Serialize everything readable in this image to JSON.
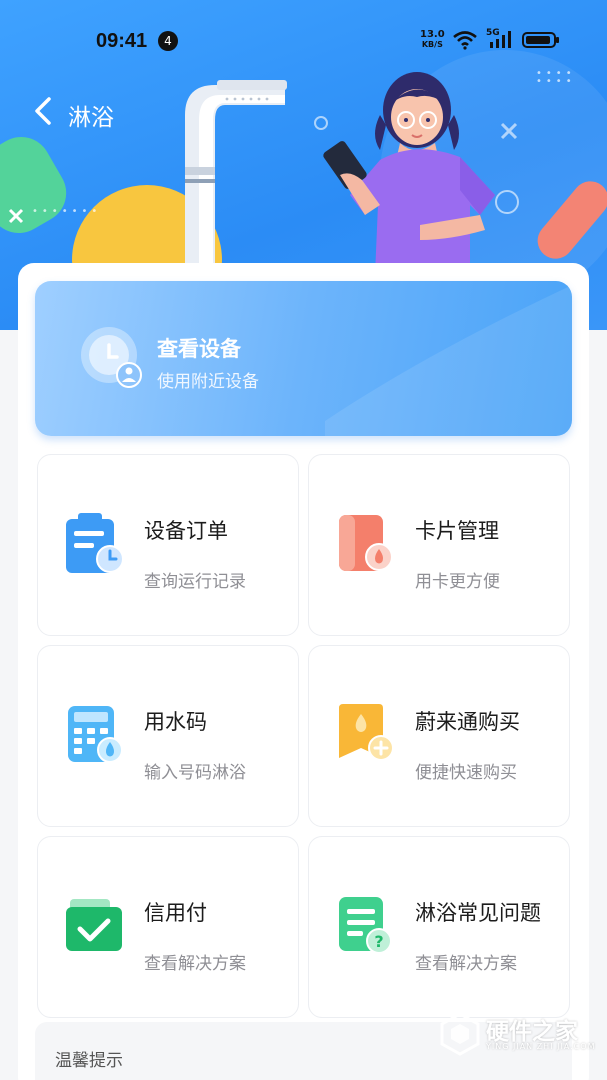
{
  "status_bar": {
    "time": "09:41",
    "notification_count": "4",
    "net_speed_value": "13.0",
    "net_speed_unit": "KB/S",
    "network_type": "5G"
  },
  "nav": {
    "title": "淋浴",
    "back_icon": "chevron-left-icon"
  },
  "primary_card": {
    "title": "查看设备",
    "subtitle": "使用附近设备",
    "icon": "clock-user-icon"
  },
  "tiles": [
    {
      "title": "设备订单",
      "subtitle": "查询运行记录",
      "icon": "clipboard-clock-icon",
      "color": "#3d9bf5"
    },
    {
      "title": "卡片管理",
      "subtitle": "用卡更方便",
      "icon": "card-drop-icon",
      "color": "#f47f6b"
    },
    {
      "title": "用水码",
      "subtitle": "输入号码淋浴",
      "icon": "keypad-drop-icon",
      "color": "#4fb6f7"
    },
    {
      "title": "蔚来通购买",
      "subtitle": "便捷快速购买",
      "icon": "bookmark-drop-plus-icon",
      "color": "#f9b737"
    },
    {
      "title": "信用付",
      "subtitle": "查看解决方案",
      "icon": "wallet-check-icon",
      "color": "#1eb86a"
    },
    {
      "title": "淋浴常见问题",
      "subtitle": "查看解决方案",
      "icon": "document-question-icon",
      "color": "#3fd08e"
    }
  ],
  "tips": {
    "title": "温馨提示"
  },
  "watermark": {
    "text": "硬件之家",
    "sub": "YING JIAN ZHI JIA.COM"
  },
  "colors": {
    "header_blue": "#2b8cf5",
    "card_blue": "#49a3f8",
    "text_primary": "#1c1c1c",
    "text_secondary": "#8f8f95"
  }
}
